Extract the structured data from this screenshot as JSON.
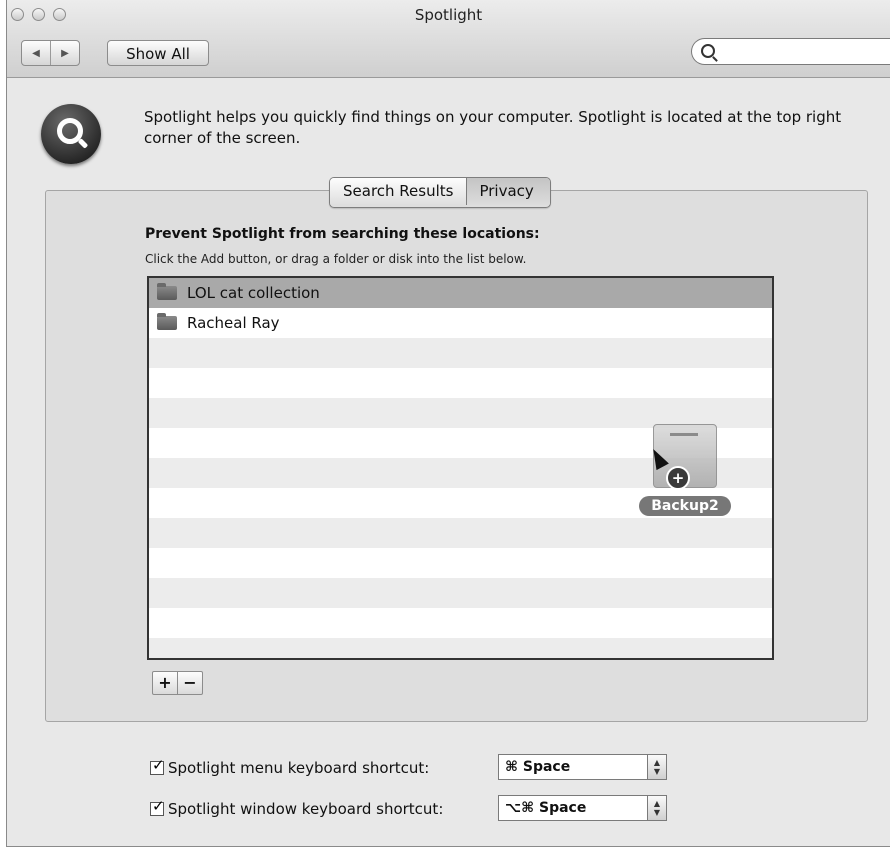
{
  "window": {
    "title": "Spotlight"
  },
  "toolbar": {
    "back_icon": "◀",
    "forward_icon": "▶",
    "show_all_label": "Show All",
    "search_placeholder": ""
  },
  "intro": {
    "text": "Spotlight helps you quickly find things on your computer. Spotlight is located at the top right corner of the screen."
  },
  "tabs": [
    {
      "label": "Search Results",
      "selected": false
    },
    {
      "label": "Privacy",
      "selected": true
    }
  ],
  "privacy": {
    "heading": "Prevent Spotlight from searching these locations:",
    "hint": "Click the Add button, or drag a folder or disk into the list below.",
    "items": [
      {
        "label": "LOL cat collection",
        "selected": true
      },
      {
        "label": "Racheal Ray",
        "selected": false
      }
    ],
    "dragging_item": {
      "label": "Backup2",
      "icon": "disk-icon"
    },
    "add_label": "+",
    "remove_label": "−"
  },
  "shortcuts": [
    {
      "label": "Spotlight menu keyboard shortcut:",
      "checked": true,
      "value": "⌘ Space"
    },
    {
      "label": "Spotlight window keyboard shortcut:",
      "checked": true,
      "value": "⌥⌘ Space"
    }
  ]
}
